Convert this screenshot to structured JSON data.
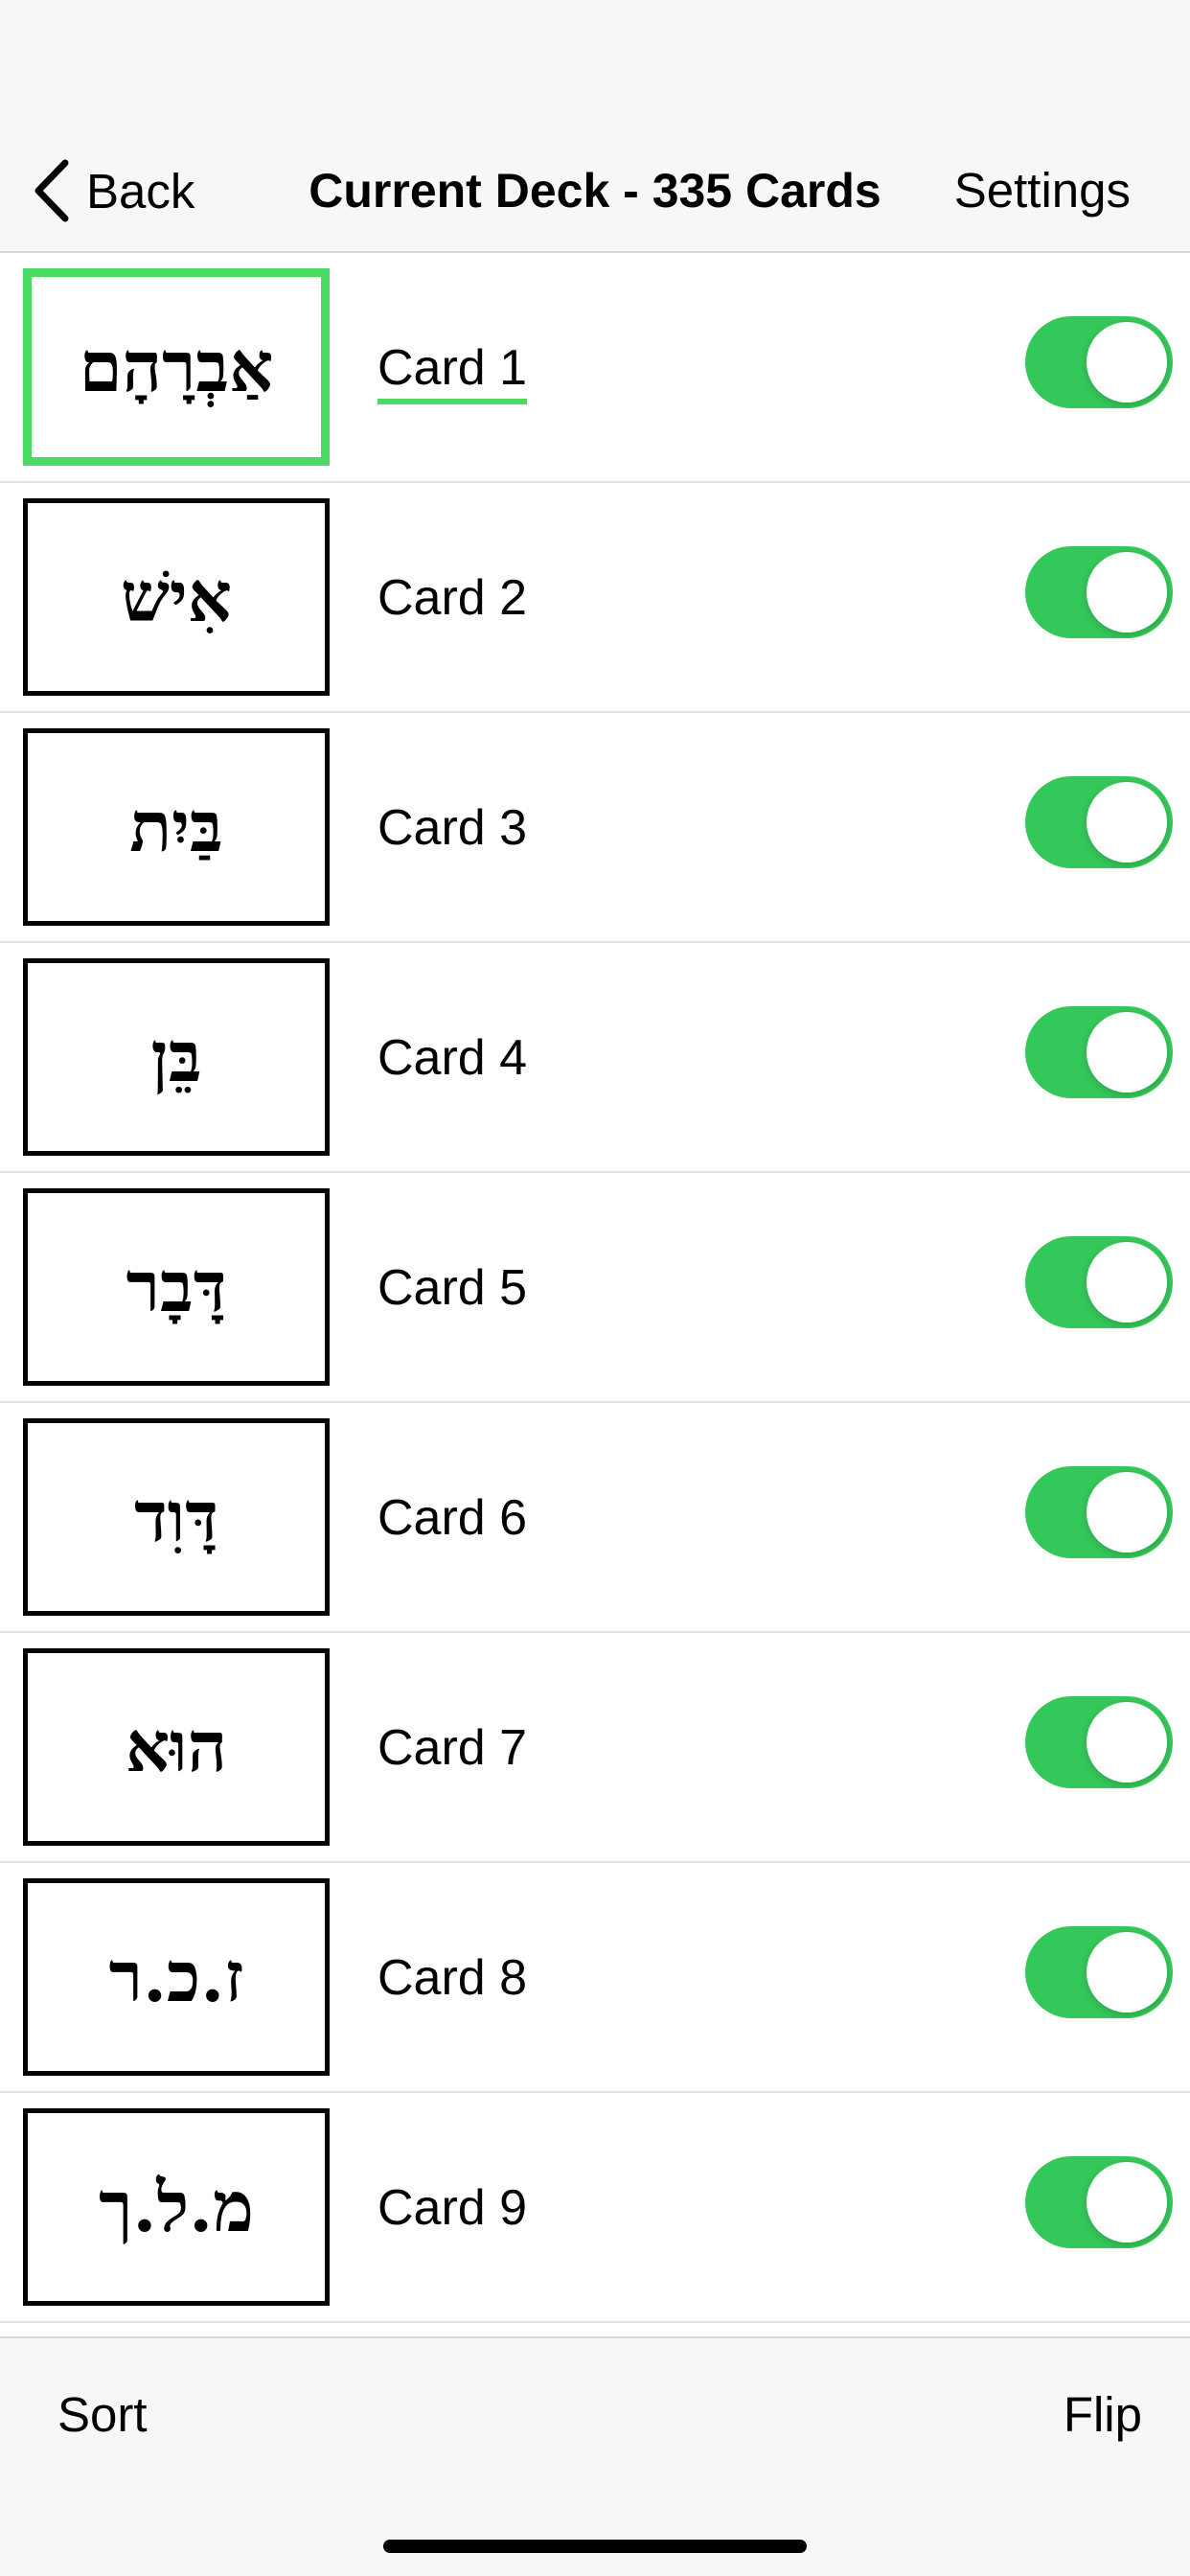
{
  "navbar": {
    "back_label": "Back",
    "title": "Current Deck - 335 Cards",
    "settings_label": "Settings"
  },
  "cards": [
    {
      "front": "אַבְרָהָם",
      "label": "Card 1",
      "enabled": true,
      "selected": true
    },
    {
      "front": "אִישׁ",
      "label": "Card 2",
      "enabled": true,
      "selected": false
    },
    {
      "front": "בַּיִת",
      "label": "Card 3",
      "enabled": true,
      "selected": false
    },
    {
      "front": "בֵּן",
      "label": "Card 4",
      "enabled": true,
      "selected": false
    },
    {
      "front": "דָּבָר",
      "label": "Card 5",
      "enabled": true,
      "selected": false
    },
    {
      "front": "דָּוִד",
      "label": "Card 6",
      "enabled": true,
      "selected": false
    },
    {
      "front": "הוּא",
      "label": "Card 7",
      "enabled": true,
      "selected": false
    },
    {
      "front": "ז.כ.ר",
      "label": "Card 8",
      "enabled": true,
      "selected": false
    },
    {
      "front": "מ.ל.ך",
      "label": "Card 9",
      "enabled": true,
      "selected": false
    }
  ],
  "toolbar": {
    "sort_label": "Sort",
    "flip_label": "Flip"
  },
  "colors": {
    "accent": "#4cd964",
    "toggle_on": "#34c759"
  }
}
